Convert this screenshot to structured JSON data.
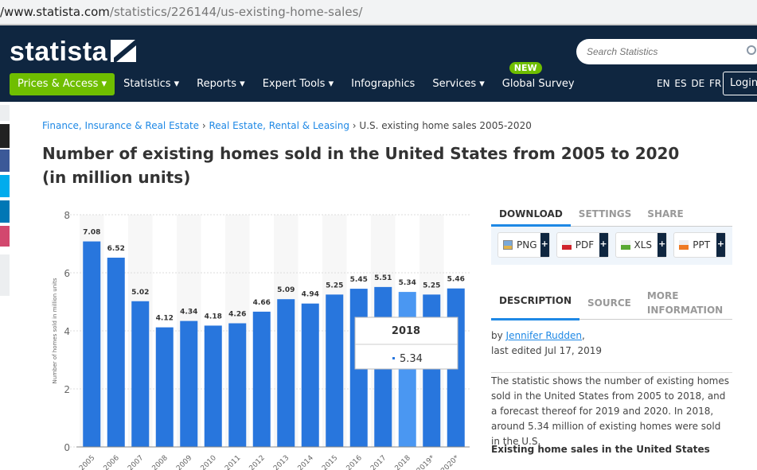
{
  "browser": {
    "url_host": "/www.statista.com",
    "url_path": "/statistics/226144/us-existing-home-sales/"
  },
  "header": {
    "logo": "statista",
    "nav": [
      {
        "label": "Prices & Access ▾"
      },
      {
        "label": "Statistics ▾"
      },
      {
        "label": "Reports ▾"
      },
      {
        "label": "Expert Tools ▾"
      },
      {
        "label": "Infographics"
      },
      {
        "label": "Services ▾"
      },
      {
        "label": "Global Survey",
        "badge": "NEW"
      }
    ],
    "search_placeholder": "Search Statistics",
    "languages": "EN ES DE FR",
    "login": "Login"
  },
  "breadcrumb": [
    "Finance, Insurance & Real Estate",
    "Real Estate, Rental & Leasing",
    "U.S. existing home sales 2005-2020"
  ],
  "title": "Number of existing homes sold in the United States from 2005 to 2020 (in million units)",
  "chart_data": {
    "type": "bar",
    "ylabel": "Number of homes sold in million units",
    "ylim": [
      0,
      8
    ],
    "yticks": [
      "0",
      "2",
      "4",
      "6",
      "8"
    ],
    "categories": [
      "2005",
      "2006",
      "2007",
      "2008",
      "2009",
      "2010",
      "2011",
      "2012",
      "2013",
      "2014",
      "2015",
      "2016",
      "2017",
      "2018",
      "2019*",
      "2020*"
    ],
    "values": [
      7.08,
      6.52,
      5.02,
      4.12,
      4.34,
      4.18,
      4.26,
      4.66,
      5.09,
      4.94,
      5.25,
      5.45,
      5.51,
      5.34,
      5.25,
      5.46
    ],
    "labels": [
      "7.08",
      "6.52",
      "5.02",
      "4.12",
      "4.34",
      "4.18",
      "4.26",
      "4.66",
      "5.09",
      "4.94",
      "5.25",
      "5.45",
      "5.51",
      "5.34",
      "5.25",
      "5.46"
    ],
    "bar_color": "#2876dd",
    "highlight_color": "#4a97f2",
    "highlighted": "2018",
    "tooltip": {
      "title": "2018",
      "value": "5.34"
    }
  },
  "panel": {
    "tabs1": [
      "DOWNLOAD",
      "SETTINGS",
      "SHARE"
    ],
    "downloads": [
      "PNG",
      "PDF",
      "XLS",
      "PPT"
    ],
    "plus": "+",
    "tabs2": [
      "DESCRIPTION",
      "SOURCE",
      "MORE INFORMATION"
    ],
    "by": "by ",
    "author": "Jennifer Rudden",
    "author_suffix": ",",
    "edited": "last edited Jul 17, 2019",
    "description": "The statistic shows the number of existing homes sold in the United States from 2005 to 2018, and a forecast thereof for 2019 and 2020. In 2018, around 5.34 million of existing homes were sold in the U.S.",
    "subheading": "Existing home sales in the United States"
  }
}
